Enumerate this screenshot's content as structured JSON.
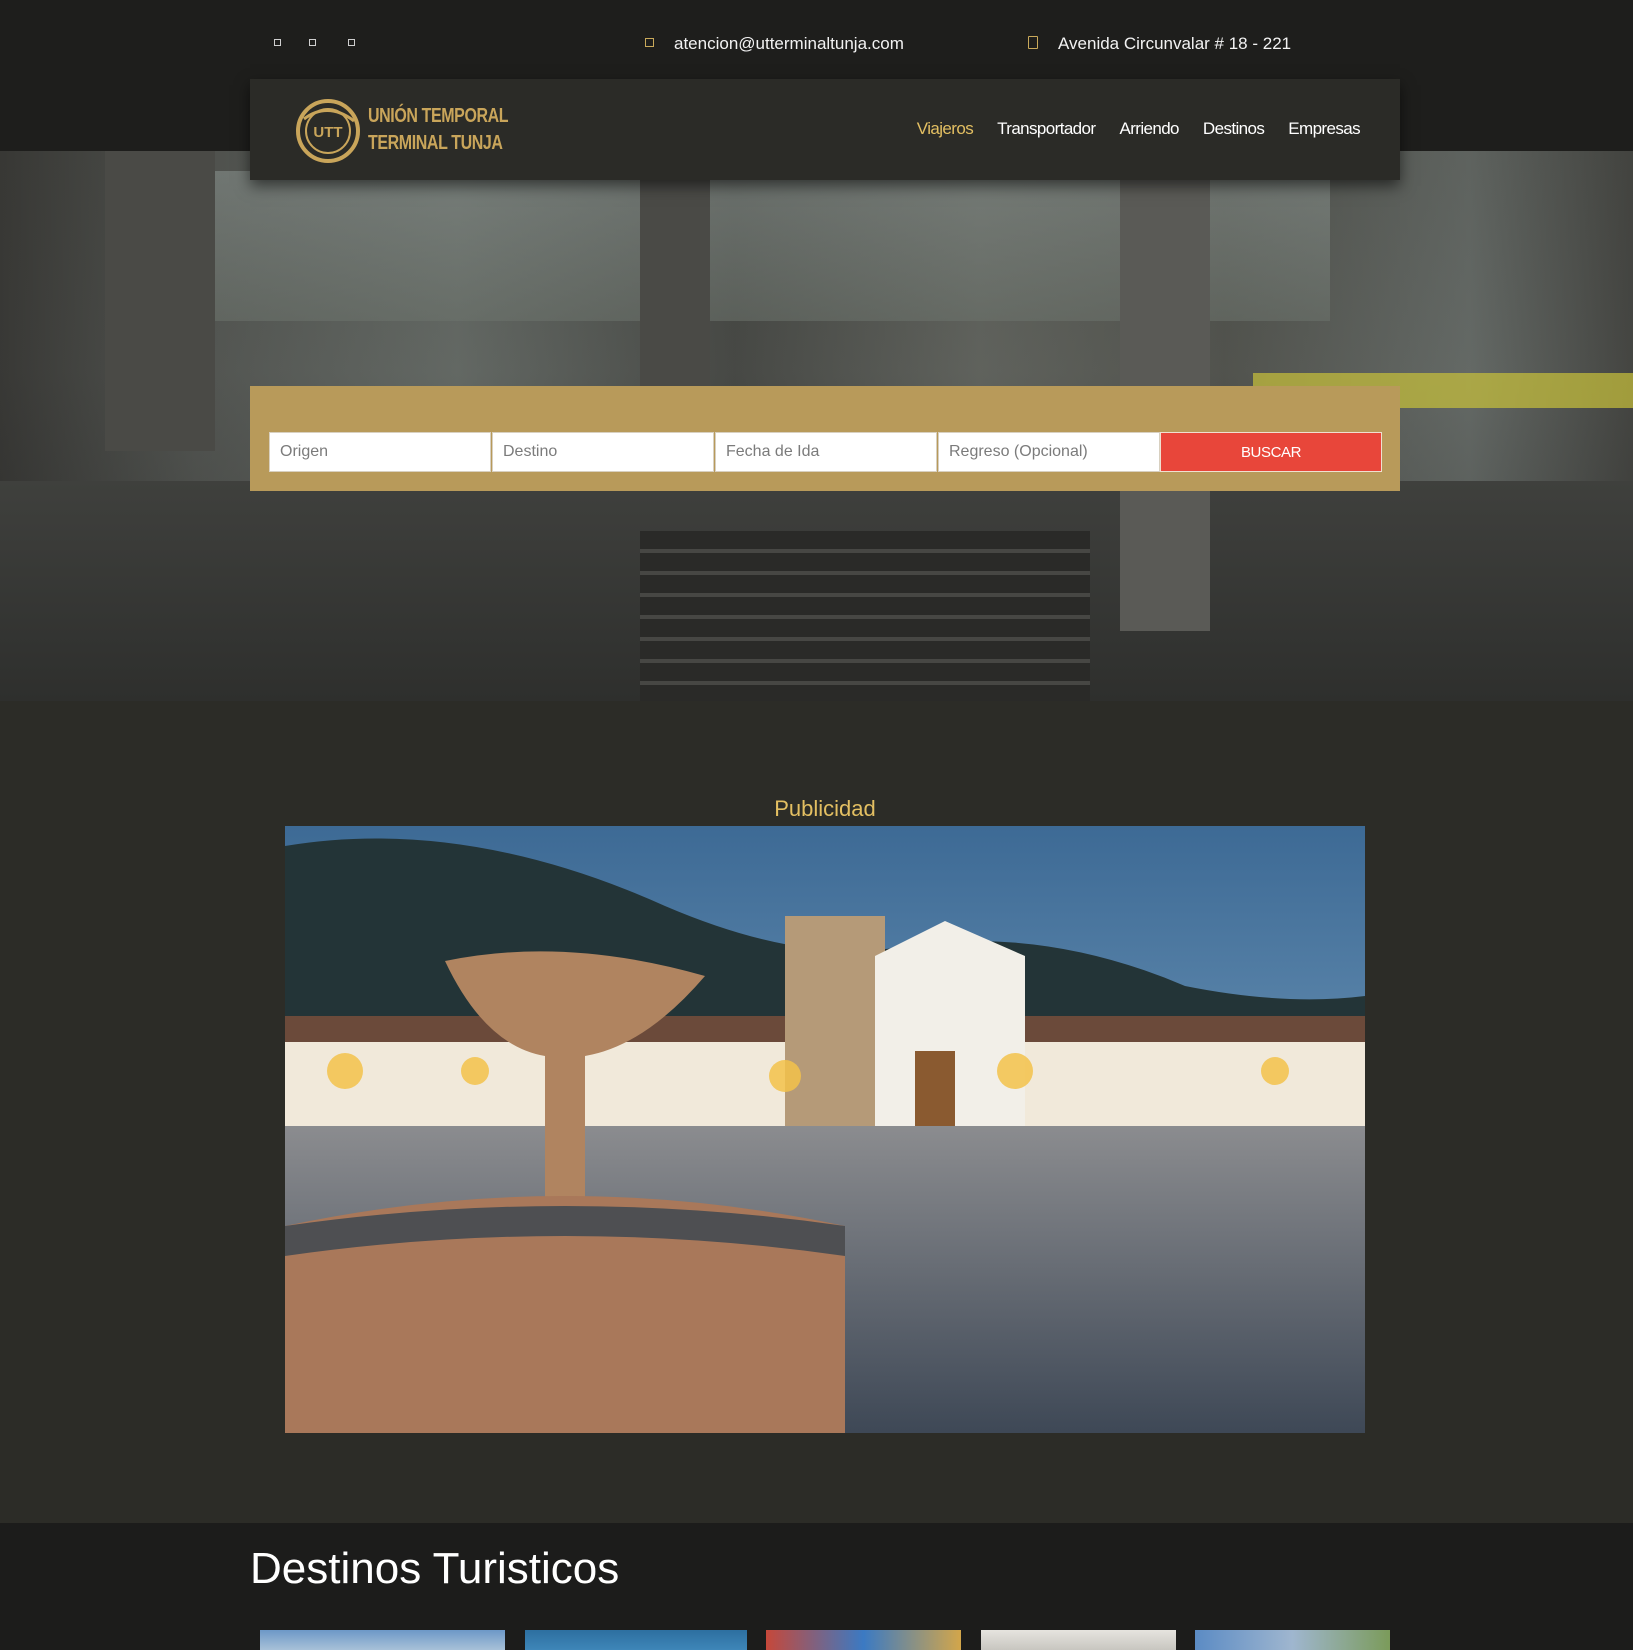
{
  "topbar": {
    "social_icons": [
      "facebook-icon",
      "instagram-icon",
      "twitter-icon"
    ],
    "email": "atencion@utterminaltunja.com",
    "address": "Avenida Circunvalar # 18 - 221"
  },
  "logo": {
    "line1": "UNIÓN TEMPORAL",
    "line2": "TERMINAL TUNJA",
    "mark": "UTT"
  },
  "nav": {
    "items": [
      "Viajeros",
      "Transportador",
      "Arriendo",
      "Destinos",
      "Empresas"
    ],
    "active": "Viajeros"
  },
  "search": {
    "origin_placeholder": "Origen",
    "destination_placeholder": "Destino",
    "departure_placeholder": "Fecha de Ida",
    "return_placeholder": "Regreso (Opcional)",
    "button_label": "BUSCAR"
  },
  "ad": {
    "title": "Publicidad"
  },
  "destinations": {
    "title": "Destinos Turisticos"
  },
  "colors": {
    "gold": "#c9a55a",
    "active_nav": "#e3bf62",
    "search_bg": "#b89a5a",
    "button": "#e8463a",
    "page_bg": "#2c2c27"
  }
}
